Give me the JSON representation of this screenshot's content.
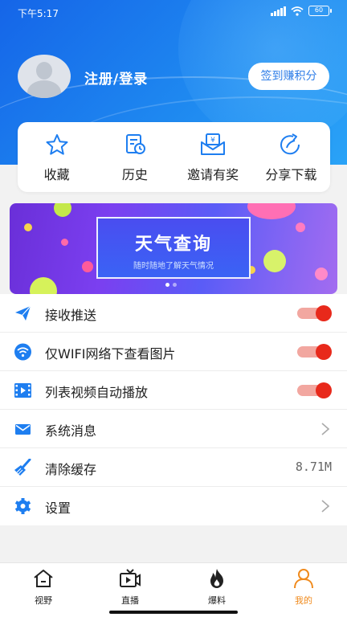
{
  "status_bar": {
    "time": "下午5:17",
    "battery": "60"
  },
  "profile": {
    "login_text": "注册/登录",
    "checkin_button": "签到赚积分"
  },
  "quick_actions": [
    {
      "icon": "star-icon",
      "label": "收藏"
    },
    {
      "icon": "history-icon",
      "label": "历史"
    },
    {
      "icon": "invite-icon",
      "label": "邀请有奖"
    },
    {
      "icon": "share-icon",
      "label": "分享下载"
    }
  ],
  "banner": {
    "title": "天气查询",
    "subtitle": "随时随地了解天气情况",
    "pages": 2,
    "active_page": 1
  },
  "settings": [
    {
      "icon": "send-icon",
      "label": "接收推送",
      "type": "toggle",
      "on": true
    },
    {
      "icon": "wifi-icon",
      "label": "仅WIFI网络下查看图片",
      "type": "toggle",
      "on": true
    },
    {
      "icon": "video-icon",
      "label": "列表视频自动播放",
      "type": "toggle",
      "on": true
    },
    {
      "icon": "mail-icon",
      "label": "系统消息",
      "type": "link"
    },
    {
      "icon": "broom-icon",
      "label": "清除缓存",
      "type": "value",
      "value": "8.71M"
    },
    {
      "icon": "gear-icon",
      "label": "设置",
      "type": "link"
    }
  ],
  "bottom_nav": [
    {
      "icon": "home-icon",
      "label": "视野",
      "active": false
    },
    {
      "icon": "tv-icon",
      "label": "直播",
      "active": false
    },
    {
      "icon": "fire-icon",
      "label": "爆料",
      "active": false
    },
    {
      "icon": "user-icon",
      "label": "我的",
      "active": true
    }
  ],
  "colors": {
    "primary": "#1e7ef0",
    "accent": "#f08a1c",
    "toggle_on": "#e8291b"
  }
}
